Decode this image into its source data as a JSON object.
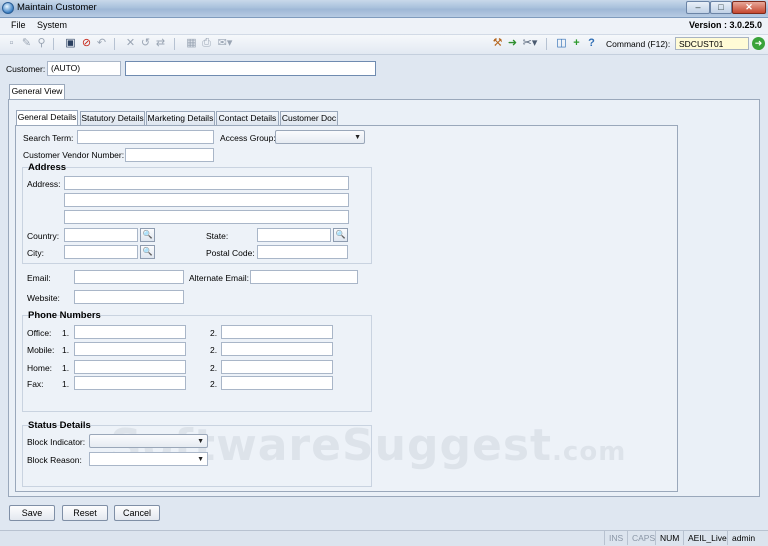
{
  "window": {
    "title": "Maintain Customer",
    "min": "–",
    "max": "□",
    "close": "✕"
  },
  "menu": {
    "items": [
      "File",
      "System"
    ],
    "version": "Version : 3.0.25.0"
  },
  "toolbar": {
    "command_label": "Command (F12):",
    "command_value": "SDCUST01",
    "icons": [
      "new-icon",
      "edit-icon",
      "find-icon",
      "save-icon",
      "cancel-icon",
      "undo-icon",
      "delete-icon",
      "revert-icon",
      "refresh-icon",
      "grid-icon",
      "print-icon",
      "email-icon",
      "tools-icon",
      "exit-icon",
      "settings-icon",
      "window-icon",
      "add-icon",
      "help-icon",
      "go-icon"
    ]
  },
  "customer": {
    "label": "Customer:",
    "code": "(AUTO)",
    "name_value": ""
  },
  "outer_tab": "General View",
  "tabs": [
    "General Details",
    "Statutory Details",
    "Marketing Details",
    "Contact Details",
    "Customer Doc"
  ],
  "general": {
    "search_term_label": "Search Term:",
    "access_group_label": "Access Group:",
    "vendor_number_label": "Customer Vendor Number:"
  },
  "address": {
    "title": "Address",
    "address_label": "Address:",
    "country_label": "Country:",
    "state_label": "State:",
    "city_label": "City:",
    "postal_label": "Postal Code:"
  },
  "contact": {
    "email_label": "Email:",
    "alt_email_label": "Alternate Email:",
    "website_label": "Website:"
  },
  "phones": {
    "title": "Phone Numbers",
    "rows": [
      {
        "label": "Office:",
        "n1": "1.",
        "n2": "2."
      },
      {
        "label": "Mobile:",
        "n1": "1.",
        "n2": "2."
      },
      {
        "label": "Home:",
        "n1": "1.",
        "n2": "2."
      },
      {
        "label": "Fax:",
        "n1": "1.",
        "n2": "2."
      }
    ]
  },
  "status_details": {
    "title": "Status Details",
    "block_indicator_label": "Block Indicator:",
    "block_reason_label": "Block Reason:"
  },
  "buttons": {
    "save": "Save",
    "reset": "Reset",
    "cancel": "Cancel"
  },
  "statusbar": [
    "INS",
    "CAPS",
    "NUM",
    "AEIL_Live",
    "admin"
  ],
  "watermark": {
    "main": "SoftwareSuggest",
    "suffix": ".com"
  },
  "colors": {
    "command_bg": "#fffbd6",
    "accent": "#2e6db4"
  }
}
